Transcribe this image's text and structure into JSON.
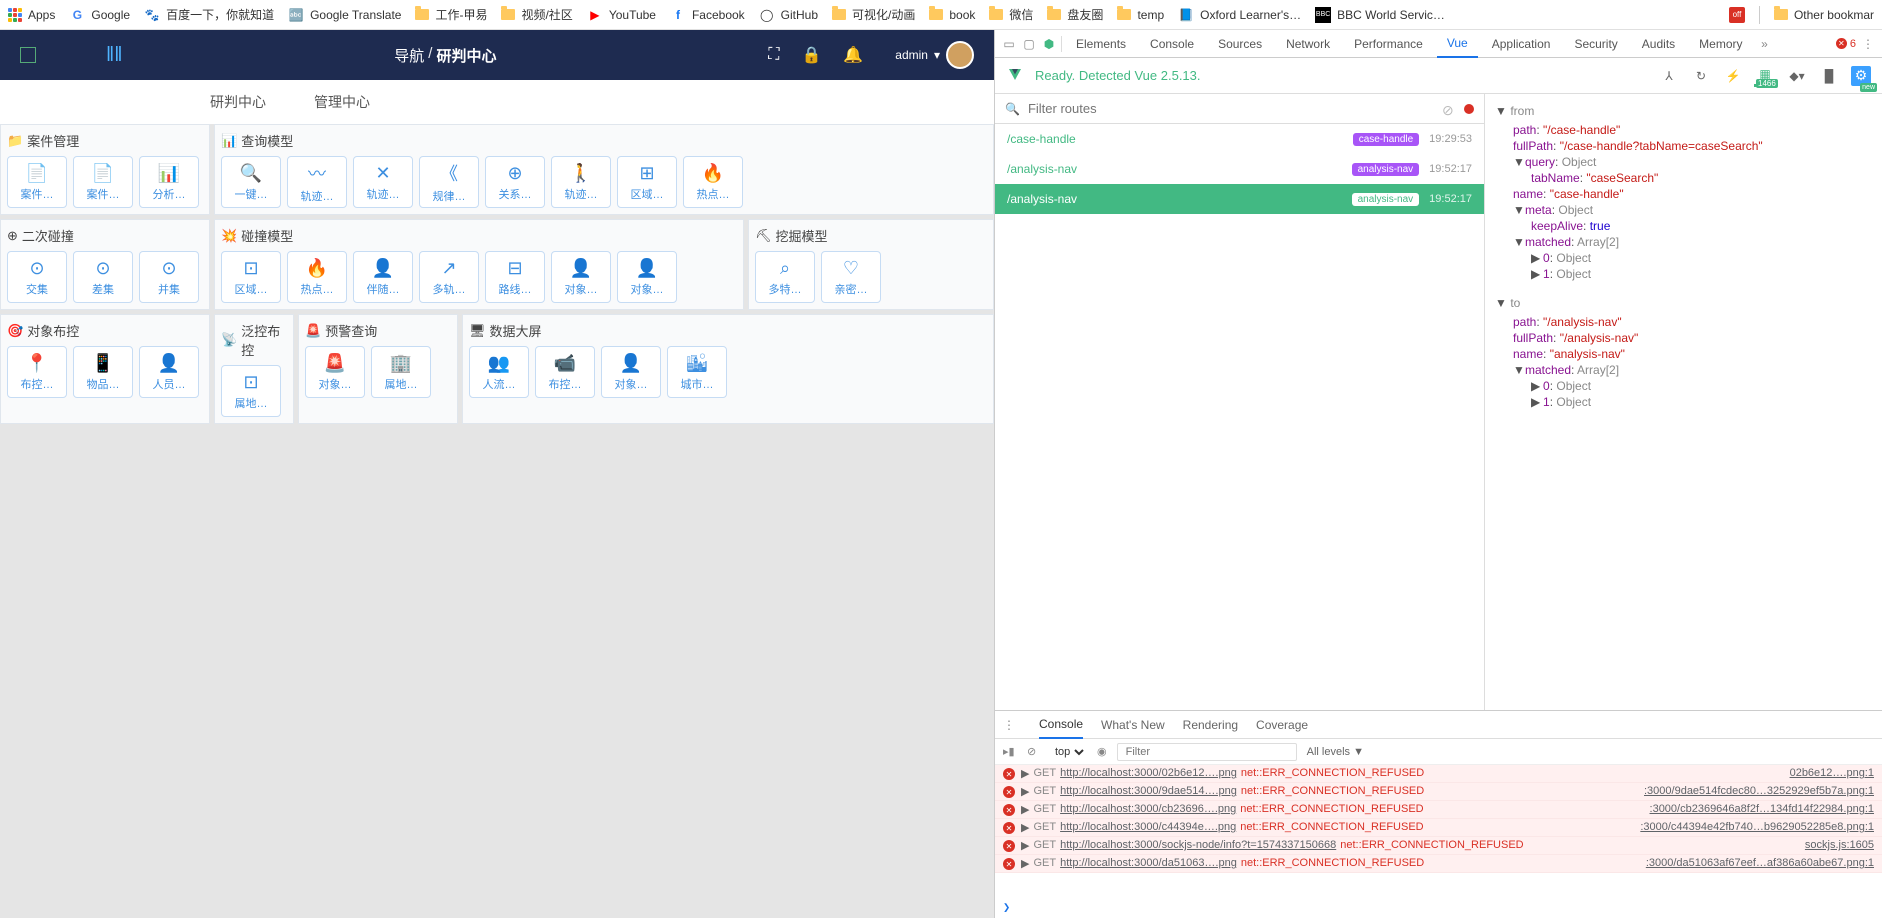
{
  "bookmarks": [
    {
      "label": "Apps",
      "icon": "apps"
    },
    {
      "label": "Google",
      "icon": "g"
    },
    {
      "label": "百度一下，你就知道",
      "icon": "baidu"
    },
    {
      "label": "Google Translate",
      "icon": "gt"
    },
    {
      "label": "工作-甲易",
      "icon": "folder"
    },
    {
      "label": "视频/社区",
      "icon": "folder"
    },
    {
      "label": "YouTube",
      "icon": "yt"
    },
    {
      "label": "Facebook",
      "icon": "fb"
    },
    {
      "label": "GitHub",
      "icon": "gh"
    },
    {
      "label": "可视化/动画",
      "icon": "folder"
    },
    {
      "label": "book",
      "icon": "folder"
    },
    {
      "label": "微信",
      "icon": "folder"
    },
    {
      "label": "盘友圈",
      "icon": "folder"
    },
    {
      "label": "temp",
      "icon": "folder"
    },
    {
      "label": "Oxford Learner's…",
      "icon": "ox"
    },
    {
      "label": "BBC World Servic…",
      "icon": "bbc"
    }
  ],
  "other_bookmarks": "Other bookmar",
  "header": {
    "breadcrumb1": "导航",
    "breadcrumb2": "研判中心",
    "user": "admin"
  },
  "subtabs": {
    "t1": "研判中心",
    "t2": "管理中心"
  },
  "panels": {
    "case": {
      "title": "案件管理",
      "tiles": [
        {
          "icon": "📄",
          "label": "案件…"
        },
        {
          "icon": "📄",
          "label": "案件…"
        },
        {
          "icon": "📊",
          "label": "分析…"
        }
      ]
    },
    "query": {
      "title": "查询模型",
      "tiles": [
        {
          "icon": "🔍",
          "label": "一键…"
        },
        {
          "icon": "〰",
          "label": "轨迹…"
        },
        {
          "icon": "✕",
          "label": "轨迹…"
        },
        {
          "icon": "《",
          "label": "规律…"
        },
        {
          "icon": "⊕",
          "label": "关系…"
        },
        {
          "icon": "🚶",
          "label": "轨迹…"
        },
        {
          "icon": "⊞",
          "label": "区域…"
        },
        {
          "icon": "🔥",
          "label": "热点…"
        }
      ]
    },
    "second": {
      "title": "二次碰撞",
      "tiles": [
        {
          "icon": "⊙",
          "label": "交集"
        },
        {
          "icon": "⊙",
          "label": "差集"
        },
        {
          "icon": "⊙",
          "label": "并集"
        }
      ]
    },
    "collision": {
      "title": "碰撞模型",
      "tiles": [
        {
          "icon": "⊡",
          "label": "区域…"
        },
        {
          "icon": "🔥",
          "label": "热点…"
        },
        {
          "icon": "👤",
          "label": "伴随…"
        },
        {
          "icon": "↗",
          "label": "多轨…"
        },
        {
          "icon": "⊟",
          "label": "路线…"
        },
        {
          "icon": "👤",
          "label": "对象…"
        },
        {
          "icon": "👤",
          "label": "对象…"
        }
      ]
    },
    "mining": {
      "title": "挖掘模型",
      "tiles": [
        {
          "icon": "⌕",
          "label": "多特…"
        },
        {
          "icon": "♡",
          "label": "亲密…"
        }
      ]
    },
    "target": {
      "title": "对象布控",
      "tiles": [
        {
          "icon": "📍",
          "label": "布控…"
        },
        {
          "icon": "📱",
          "label": "物品…"
        },
        {
          "icon": "👤",
          "label": "人员…"
        }
      ]
    },
    "pan": {
      "title": "泛控布控",
      "tiles": [
        {
          "icon": "⊡",
          "label": "属地…"
        }
      ]
    },
    "alert": {
      "title": "预警查询",
      "tiles": [
        {
          "icon": "🚨",
          "label": "对象…"
        },
        {
          "icon": "🏢",
          "label": "属地…"
        }
      ]
    },
    "bigscreen": {
      "title": "数据大屏",
      "tiles": [
        {
          "icon": "👥",
          "label": "人流…"
        },
        {
          "icon": "📹",
          "label": "布控…"
        },
        {
          "icon": "👤",
          "label": "对象…"
        },
        {
          "icon": "🏙",
          "label": "城市…"
        }
      ]
    }
  },
  "devtools": {
    "tabs": [
      "Elements",
      "Console",
      "Sources",
      "Network",
      "Performance",
      "Vue",
      "Application",
      "Security",
      "Audits",
      "Memory"
    ],
    "error_count": "6",
    "vue_status": "Ready. Detected Vue 2.5.13.",
    "perf_badge": "1466",
    "filter_placeholder": "Filter routes",
    "routes": [
      {
        "path": "/case-handle",
        "badge": "case-handle",
        "time": "19:29:53"
      },
      {
        "path": "/analysis-nav",
        "badge": "analysis-nav",
        "time": "19:52:17"
      },
      {
        "path": "/analysis-nav",
        "badge": "analysis-nav",
        "time": "19:52:17"
      }
    ],
    "inspector": {
      "from_label": "from",
      "from": {
        "path": "\"/case-handle\"",
        "fullPath": "\"/case-handle?tabName=caseSearch\"",
        "query_label": "Object",
        "tabName": "\"caseSearch\"",
        "name": "\"case-handle\"",
        "meta_label": "Object",
        "keepAlive": "true",
        "matched_label": "Array[2]",
        "m0": "Object",
        "m1": "Object"
      },
      "to_label": "to",
      "to": {
        "path": "\"/analysis-nav\"",
        "fullPath": "\"/analysis-nav\"",
        "name": "\"analysis-nav\"",
        "matched_label": "Array[2]",
        "m0": "Object",
        "m1": "Object"
      }
    },
    "drawer_tabs": [
      "Console",
      "What's New",
      "Rendering",
      "Coverage"
    ],
    "context": "top",
    "filter": "Filter",
    "levels": "All levels ▼",
    "logs": [
      {
        "method": "GET",
        "url": "http://localhost:3000/02b6e12….png",
        "err": "net::ERR_CONNECTION_REFUSED",
        "src": "02b6e12….png:1"
      },
      {
        "method": "GET",
        "url": "http://localhost:3000/9dae514….png",
        "err": "net::ERR_CONNECTION_REFUSED",
        "src": ":3000/9dae514fcdec80…3252929ef5b7a.png:1"
      },
      {
        "method": "GET",
        "url": "http://localhost:3000/cb23696….png",
        "err": "net::ERR_CONNECTION_REFUSED",
        "src": ":3000/cb2369646a8f2f…134fd14f22984.png:1"
      },
      {
        "method": "GET",
        "url": "http://localhost:3000/c44394e….png",
        "err": "net::ERR_CONNECTION_REFUSED",
        "src": ":3000/c44394e42fb740…b9629052285e8.png:1"
      },
      {
        "method": "GET",
        "url": "http://localhost:3000/sockjs-node/info?t=1574337150668",
        "err": "net::ERR_CONNECTION_REFUSED",
        "src": "sockjs.js:1605"
      },
      {
        "method": "GET",
        "url": "http://localhost:3000/da51063….png",
        "err": "net::ERR_CONNECTION_REFUSED",
        "src": ":3000/da51063af67eef…af386a60abe67.png:1"
      }
    ]
  }
}
